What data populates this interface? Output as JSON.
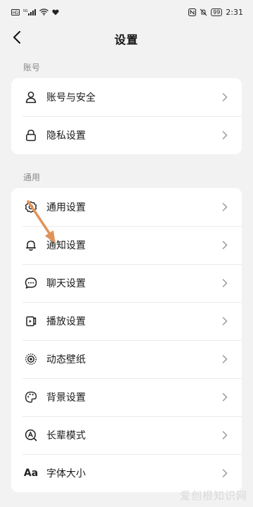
{
  "status_bar": {
    "left_badges": [
      "HD",
      "5G"
    ],
    "battery": "99",
    "time": "2:31"
  },
  "header": {
    "title": "设置"
  },
  "sections": [
    {
      "label": "账号",
      "items": [
        {
          "label": "账号与安全",
          "icon": "person-icon"
        },
        {
          "label": "隐私设置",
          "icon": "lock-icon"
        }
      ]
    },
    {
      "label": "通用",
      "items": [
        {
          "label": "通用设置",
          "icon": "gear-icon"
        },
        {
          "label": "通知设置",
          "icon": "bell-icon"
        },
        {
          "label": "聊天设置",
          "icon": "chat-bubble-icon"
        },
        {
          "label": "播放设置",
          "icon": "play-settings-icon"
        },
        {
          "label": "动态壁纸",
          "icon": "live-wallpaper-icon"
        },
        {
          "label": "背景设置",
          "icon": "palette-icon"
        },
        {
          "label": "长辈模式",
          "icon": "elder-mode-icon"
        },
        {
          "label": "字体大小",
          "icon": "font-size-icon",
          "glyph": "Aa"
        }
      ]
    }
  ],
  "annotation": {
    "color": "#e0945a"
  },
  "watermark": "爱创根知识网"
}
